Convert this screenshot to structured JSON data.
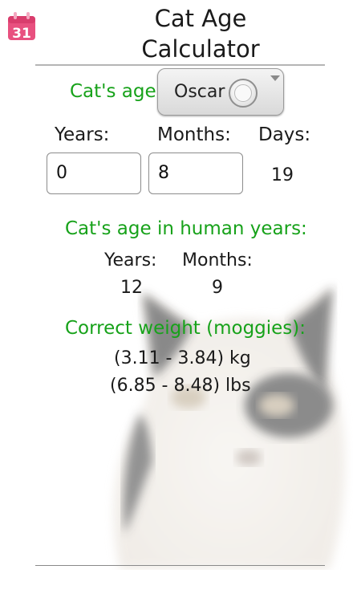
{
  "header": {
    "calendar_icon": "calendar-icon",
    "calendar_day": "31",
    "title_line1": "Cat Age",
    "title_line2": "Calculator"
  },
  "input": {
    "cats_age_label": "Cat's age:",
    "cat_selector_value": "Oscar",
    "years_label": "Years:",
    "months_label": "Months:",
    "days_label": "Days:",
    "years_value": "0",
    "months_value": "8",
    "days_value": "19"
  },
  "human": {
    "heading": "Cat's age in human years:",
    "years_label": "Years:",
    "months_label": "Months:",
    "years_value": "12",
    "months_value": "9"
  },
  "weight": {
    "heading": "Correct weight (moggies):",
    "kg_range": "(3.11 - 3.84) kg",
    "lbs_range": "(6.85 - 8.48) lbs"
  },
  "colors": {
    "accent_green": "#17a21a",
    "calendar_pink": "#e8507f"
  },
  "background_image": "cat-photo"
}
